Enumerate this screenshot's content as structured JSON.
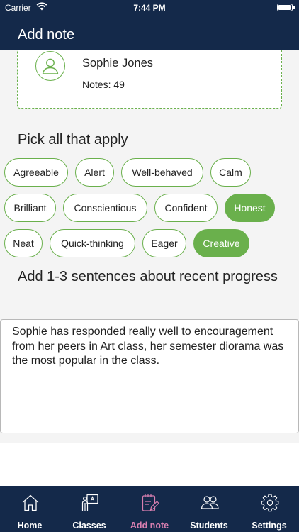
{
  "status_bar": {
    "carrier": "Carrier",
    "time": "7:44 PM",
    "battery_level": 1.0
  },
  "nav": {
    "title": "Add note"
  },
  "student": {
    "name": "Sophie Jones",
    "notes": "Notes: 49",
    "avatar_icon": "person-icon"
  },
  "traits": {
    "title": "Pick all that apply",
    "items": [
      {
        "label": "Agreeable",
        "selected": false
      },
      {
        "label": "Alert",
        "selected": false
      },
      {
        "label": "Well-behaved",
        "selected": false
      },
      {
        "label": "Calm",
        "selected": false
      },
      {
        "label": "Brilliant",
        "selected": false
      },
      {
        "label": "Conscientious",
        "selected": false
      },
      {
        "label": "Confident",
        "selected": false
      },
      {
        "label": "Honest",
        "selected": true
      },
      {
        "label": "Neat",
        "selected": false
      },
      {
        "label": "Quick-thinking",
        "selected": false
      },
      {
        "label": "Eager",
        "selected": false
      },
      {
        "label": "Creative",
        "selected": true
      }
    ]
  },
  "progress": {
    "title": "Add 1-3 sentences about recent progress",
    "text": "Sophie has responded really well to encouragement from her peers in Art class, her semester diorama was the most popular in the class."
  },
  "tab_bar": {
    "items": [
      {
        "label": "Home",
        "icon": "home-icon",
        "active": false
      },
      {
        "label": "Classes",
        "icon": "classroom-icon",
        "active": false
      },
      {
        "label": "Add note",
        "icon": "add-note-icon",
        "active": true
      },
      {
        "label": "Students",
        "icon": "students-icon",
        "active": false
      },
      {
        "label": "Settings",
        "icon": "gear-icon",
        "active": false
      }
    ]
  },
  "colors": {
    "header": "#14294a",
    "accent_green": "#6ab04c",
    "active_tab": "#d87fb0",
    "content_bg": "#f4f4f4"
  }
}
